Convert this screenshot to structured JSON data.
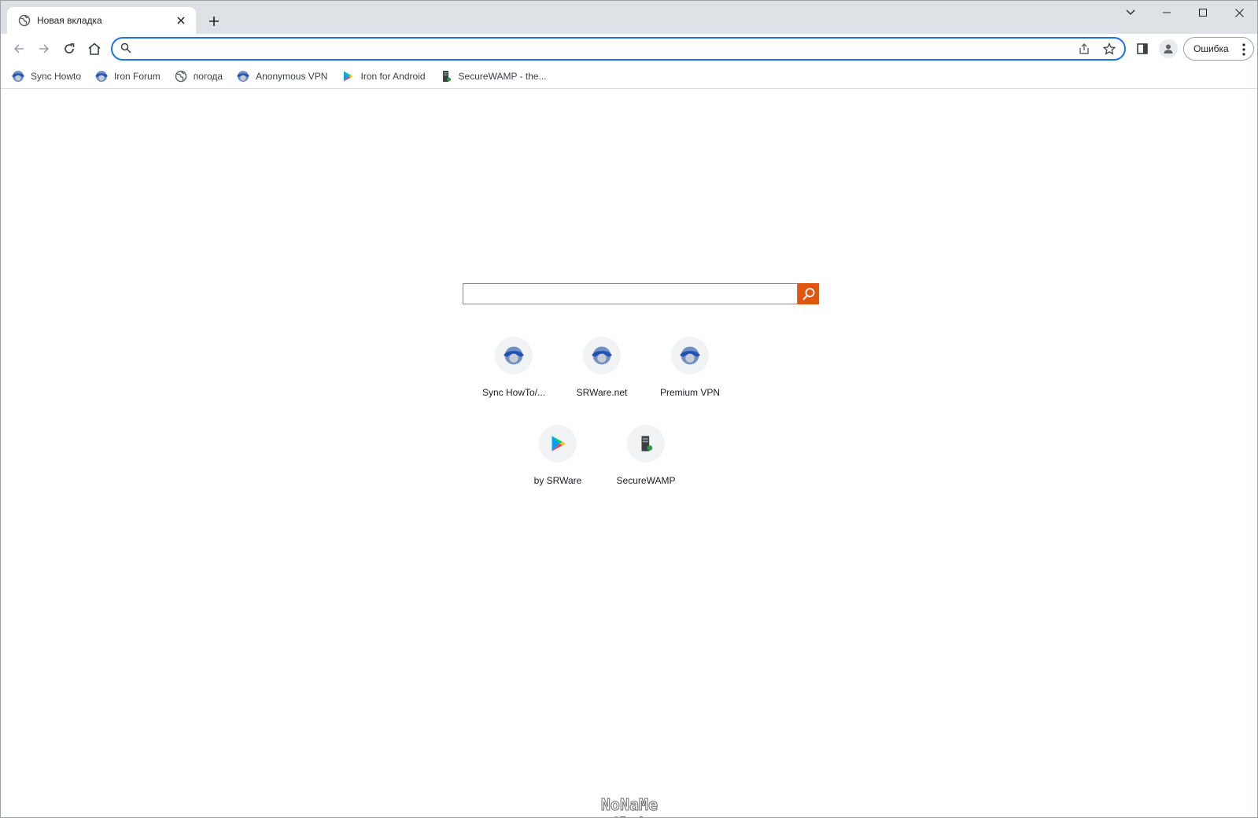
{
  "tab": {
    "title": "Новая вкладка"
  },
  "omnibox": {
    "value": "",
    "placeholder": ""
  },
  "profile": {
    "error_label": "Ошибка"
  },
  "bookmarks": [
    {
      "label": "Sync Howto",
      "icon": "iron-globe-icon"
    },
    {
      "label": "Iron Forum",
      "icon": "iron-globe-icon"
    },
    {
      "label": "погода",
      "icon": "globe-icon"
    },
    {
      "label": "Anonymous VPN",
      "icon": "iron-globe-icon"
    },
    {
      "label": "Iron for Android",
      "icon": "play-store-icon"
    },
    {
      "label": "SecureWAMP - the...",
      "icon": "server-icon"
    }
  ],
  "search": {
    "value": ""
  },
  "shortcuts": [
    {
      "label": "Sync HowTo/...",
      "icon": "iron-globe-icon"
    },
    {
      "label": "SRWare.net",
      "icon": "iron-globe-icon"
    },
    {
      "label": "Premium VPN",
      "icon": "iron-globe-icon"
    },
    {
      "label": "by SRWare",
      "icon": "play-store-icon"
    },
    {
      "label": "SecureWAMP",
      "icon": "server-icon"
    }
  ],
  "watermark": "NoNaMe Club",
  "colors": {
    "accent": "#1a73e8",
    "search_button": "#e0560e",
    "tabstrip": "#dee1e6"
  }
}
